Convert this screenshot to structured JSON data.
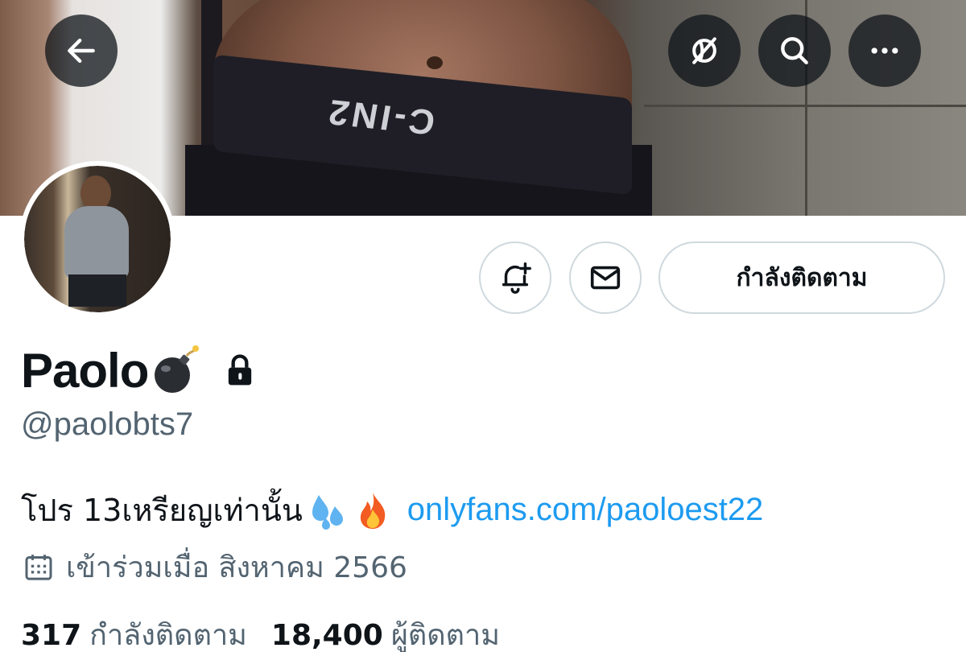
{
  "header": {
    "back_icon": "arrow-left-icon",
    "translate_icon": "translate-off-icon",
    "search_icon": "search-icon",
    "more_icon": "more-horizontal-icon"
  },
  "banner": {
    "brand_text": "C-IN2"
  },
  "actions": {
    "notify_icon": "bell-plus-icon",
    "message_icon": "mail-icon",
    "follow_label": "กำลังติดตาม"
  },
  "profile": {
    "display_name": "Paolo",
    "name_emoji": "bomb-emoji",
    "protected_icon": "lock-icon",
    "handle": "@paolobts7",
    "bio_text": "โปร 13เหรียญเท่านั้น",
    "bio_emojis": [
      "sweat-droplets-emoji",
      "fire-emoji"
    ],
    "bio_link": "onlyfans.com/paoloest22",
    "joined_icon": "calendar-icon",
    "joined_text": "เข้าร่วมเมื่อ สิงหาคม 2566"
  },
  "stats": {
    "following_count": "317",
    "following_label": "กำลังติดตาม",
    "followers_count": "18,400",
    "followers_label": "ผู้ติดตาม"
  },
  "colors": {
    "link": "#1d9bf0",
    "text": "#0f1419",
    "secondary": "#536471",
    "border": "#cfd9de"
  }
}
